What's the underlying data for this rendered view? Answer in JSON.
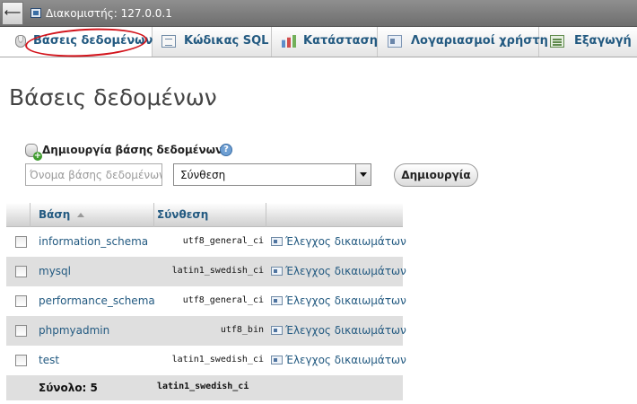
{
  "server_bar": {
    "back_label": "⟵",
    "server_text": "Διακομιστής: 127.0.0.1"
  },
  "tabs": [
    {
      "label": "Βάσεις δεδομένων",
      "icon": "database-icon",
      "active": true
    },
    {
      "label": "Κώδικας SQL",
      "icon": "sql-icon",
      "active": false
    },
    {
      "label": "Κατάσταση",
      "icon": "status-chart-icon",
      "active": false
    },
    {
      "label": "Λογαριασμοί χρήστη",
      "icon": "user-accounts-icon",
      "active": false
    },
    {
      "label": "Εξαγωγή",
      "icon": "export-icon",
      "active": false
    }
  ],
  "annotation_color": "#d2141c",
  "page_title": "Βάσεις δεδομένων",
  "create_db": {
    "title": "Δημιουργία βάσης δεδομένων",
    "help_symbol": "?",
    "name_placeholder": "Όνομα βάσης δεδομένων",
    "collation_value": "Σύνθεση",
    "button_label": "Δημιουργία"
  },
  "table": {
    "headers": {
      "database": "Βάση",
      "collation": "Σύνθεση"
    },
    "rows": [
      {
        "name": "information_schema",
        "collation": "utf8_general_ci",
        "privileges": "Έλεγχος δικαιωμάτων"
      },
      {
        "name": "mysql",
        "collation": "latin1_swedish_ci",
        "privileges": "Έλεγχος δικαιωμάτων"
      },
      {
        "name": "performance_schema",
        "collation": "utf8_general_ci",
        "privileges": "Έλεγχος δικαιωμάτων"
      },
      {
        "name": "phpmyadmin",
        "collation": "utf8_bin",
        "privileges": "Έλεγχος δικαιωμάτων"
      },
      {
        "name": "test",
        "collation": "latin1_swedish_ci",
        "privileges": "Έλεγχος δικαιωμάτων"
      }
    ],
    "total_label": "Σύνολο: 5",
    "total_collation": "latin1_swedish_ci"
  },
  "colors": {
    "link": "#235a81",
    "row_alt": "#dfdfdf"
  }
}
